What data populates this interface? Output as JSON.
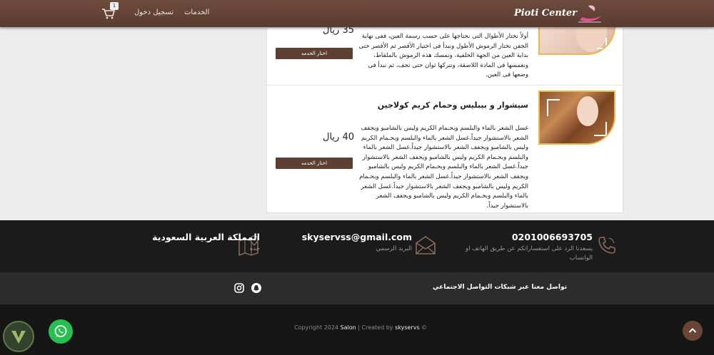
{
  "header": {
    "logo_text": "Pioti Center",
    "nav": {
      "services": "الخدمات",
      "login": "تسجيل دخول"
    },
    "cart_count": "1"
  },
  "services": [
    {
      "title": "",
      "description": "أولاً نختار الأطوال التى نحتاجها على حسب رسمة العين، ففى نهاية الجفن نختار الرموش الأطول ونبدأ فى اختيار الأقصر ثم الأقصر حتى بداية العين من الجهة الخلفية، ونمسك هذه الرموش بالملقاط، ونغمسها فى المادة اللاصقة، ونتركها ثوان حتى تجف، ثم نبدأ فى وضعها فى العين.",
      "price": "35 ريال",
      "button": "اختار الخدمه"
    },
    {
      "title": "سيشوار و بيبليس وحمام كريم كولاجين",
      "description": "غسل الشعر بالماء والبلسم وبحـمام الكريم وليس بالشامبو ويجفف الشعر بالاستشوار جيداً.غسل الشعر بالماء والبلسم وبحـمام الكريم وليس بالشامبو ويجفف الشعر بالاستشوار جيداً.غسل الشعر بالماء والبلسم وبحـمام الكريم وليس بالشامبو ويجفف الشعر بالاستشوار جيداً.غسل الشعر بالماء والبلسم وبحـمام الكريم وليس بالشامبو ويجفف الشعر بالاستشوار جيداً.غسل الشعر بالماء والبلسم وبحـمام الكريم وليس بالشامبو ويجفف الشعر بالاستشوار جيداً.غسل الشعر بالماء والبلسم وبحـمام الكريم وليس بالشامبو ويجفف الشعر بالاستشوار جيداً.",
      "price": "40 ريال",
      "button": "اختار الخدمه"
    }
  ],
  "contact": {
    "phone": {
      "title": "0201006693705",
      "sub": "يسعدنا الرد على استفساراتكم عن طريق الهاتف او الواتساب"
    },
    "email": {
      "title": "skyservss@gmail.com",
      "sub": "البريد الرسمي"
    },
    "location": {
      "title": "المملكة العربية السعودية",
      "sub": "جده"
    }
  },
  "social": {
    "text": "تواصل معنا عبر شبكات التواصل الاجتماعي"
  },
  "copyright": {
    "prefix": "Copyright 2024",
    "brand": "Salon",
    "middle": "| Created by",
    "creator": "skyservs",
    "suffix": "©"
  },
  "colors": {
    "header": "#5f3f31",
    "button": "#5f3f31",
    "whatsapp": "#25c04f",
    "footer": "#1b1b1b"
  },
  "icons": [
    "cart-icon",
    "phone-icon",
    "envelope-icon",
    "map-pin-icon",
    "snapchat-icon",
    "instagram-icon",
    "whatsapp-icon",
    "chevron-up-icon"
  ]
}
